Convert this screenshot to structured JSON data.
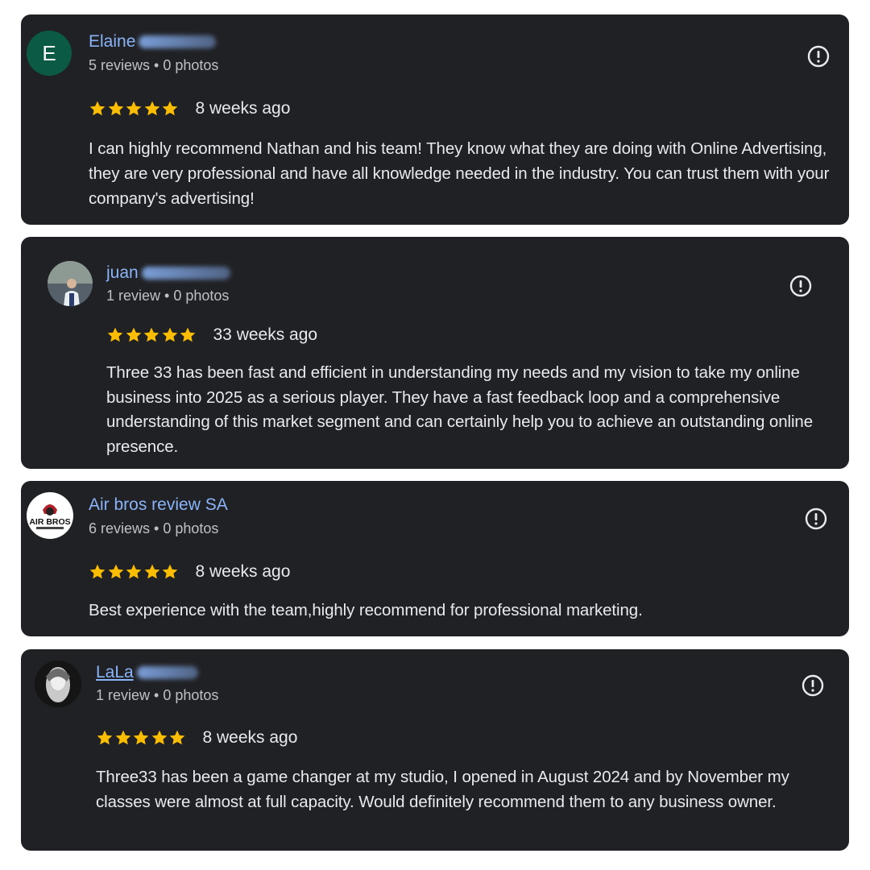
{
  "reviews": [
    {
      "name": "Elaine",
      "avatar_letter": "E",
      "meta": "5 reviews • 0 photos",
      "rating": 5,
      "time": "8 weeks ago",
      "text": "I can highly recommend Nathan and his team! They know what they are doing with Online Advertising, they are very professional and have all knowledge needed in the industry. You can trust them with your company's advertising!"
    },
    {
      "name": "juan",
      "meta": "1 review • 0 photos",
      "rating": 5,
      "time": "33 weeks ago",
      "text": "Three 33 has been fast and efficient in understanding my needs and my vision to take my online business into 2025 as a serious player. They have a fast feedback loop and a comprehensive understanding of this market segment and can certainly help you to achieve an outstanding online presence."
    },
    {
      "name": "Air bros review SA",
      "avatar_logo_text": "AIR BROS",
      "meta": "6 reviews • 0 photos",
      "rating": 5,
      "time": "8 weeks ago",
      "text": "Best experience with the team,highly recommend for professional marketing."
    },
    {
      "name": "LaLa",
      "meta": "1 review • 0 photos",
      "rating": 5,
      "time": "8 weeks ago",
      "text": "Three33 has been a game changer at my studio, I opened in August 2024 and by November my classes were almost at full capacity. Would definitely recommend them to any business owner."
    }
  ],
  "colors": {
    "card_bg": "#202124",
    "name": "#8ab4f8",
    "star": "#fbbc04",
    "text": "#e8eaed",
    "meta": "#bdc1c6"
  },
  "icons": {
    "flag": "report-flag-icon",
    "star": "star-icon"
  }
}
